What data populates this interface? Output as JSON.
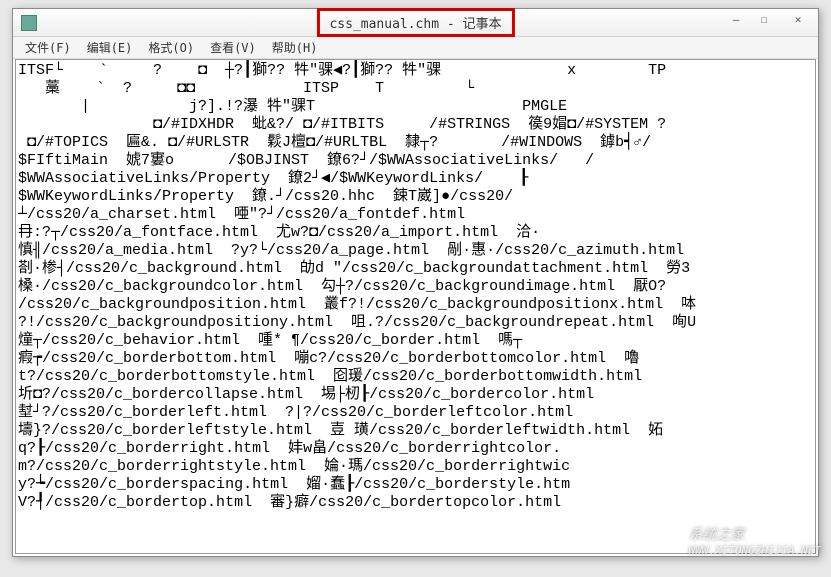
{
  "window": {
    "title": "css_manual.chm - 记事本"
  },
  "menu": {
    "file": "文件(F)",
    "edit": "编辑(E)",
    "format": "格式(O)",
    "view": "查看(V)",
    "help": "帮助(H)"
  },
  "controls": {
    "minimize": "—",
    "maximize": "☐",
    "close": "✕"
  },
  "content": {
    "lines": [
      "ITSF└    `     ?    ◘  ┼?┃獅?? 牪\"骒◀?┃獅?? 牪\"骒              x        TP",
      "   藁    `  ?     ◘◘            ITSP    T         └            ",
      "       |           j?].!?瀑 牪\"骒T                       PMGLE",
      "               ◘/#IDXHDR  蚍&?/ ◘/#ITBITS     /#STRINGS  篌9媢◘/#SYSTEM ?",
      " ◘/#TOPICS  匾&. ◘/#URLSTR  鬏J檀◘/#URLTBL  隸┬?       /#WINDOWS  鏬b┥♂/",
      "$FIftiMain  婋7寠o      /$OBJINST  鐐6?┘/$WWAssociativeLinks/   /",
      "$WWAssociativeLinks/Property  鐐2┘◀/$WWKeywordLinks/    ┠",
      "$WWKeywordLinks/Property  鐐.┘/css20.hhc  鋉T崴]●/css20/",
      "┴/css20/a_charset.html  唖\"?┘/css20/a_fontdef.html",
      "冄:?┬/css20/a_fontface.html  尤w?◘/css20/a_import.html  洽·",
      "慎╢/css20/a_media.html  ?y?└/css20/a_page.html  剮·惠·/css20/c_azimuth.html",
      "剳·椮┤/css20/c_background.html  劰d \"/css20/c_backgroundattachment.html  勞3",
      "槡·/css20/c_backgroundcolor.html  勾┼?/css20/c_backgroundimage.html  厭O?",
      "/css20/c_backgroundposition.html  叢f?!/css20/c_backgroundpositionx.html  呠",
      "?!/css20/c_backgroundpositiony.html  咀.?/css20/c_backgroundrepeat.html  咰U",
      "燑┬/css20/c_behavior.html  喠* ¶/css20/c_border.html  嗎┬",
      "瘕┮/css20/c_borderbottom.html  嘣c?/css20/c_borderbottomcolor.html  嚕",
      "t?/css20/c_borderbottomstyle.html  囵瑗/css20/c_borderbottomwidth.html",
      "圻◘?/css20/c_bordercollapse.html  埸├杒┠/css20/c_bordercolor.html",
      "堼┘?/css20/c_borderleft.html  ?|?/css20/c_borderleftcolor.html",
      "壔}?/css20/c_borderleftstyle.html  壴 璜/css20/c_borderleftwidth.html  妬",
      "q?┠/css20/c_borderright.html  妦w畠/css20/c_borderrightcolor.",
      "m?/css20/c_borderrightstyle.html  婨·瑪/css20/c_borderrightwic",
      "y?┶/css20/c_borderspacing.html  媹·蠢┠/css20/c_borderstyle.htm",
      "V?┦/css20/c_bordertop.html  審}癖/css20/c_bordertopcolor.html"
    ]
  },
  "watermark": {
    "text": "系统之家",
    "url": "WWW.XITONGZHIJIA.NET"
  }
}
